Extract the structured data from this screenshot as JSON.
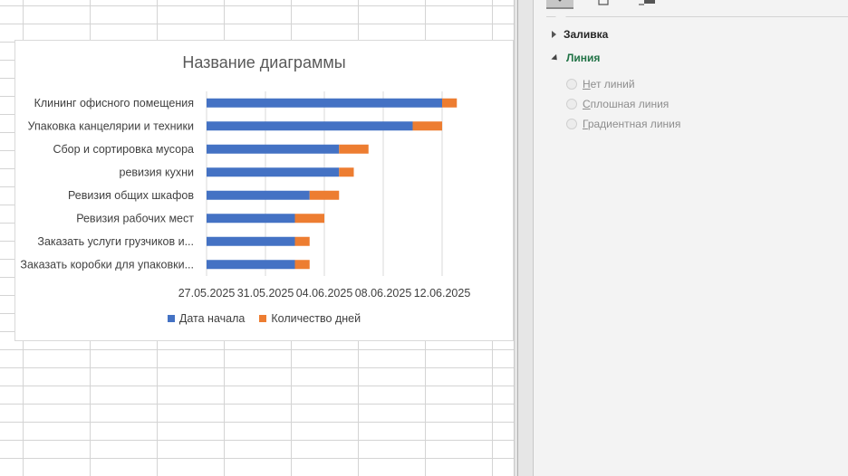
{
  "pane": {
    "sections": [
      {
        "label": "Заливка",
        "expanded": false
      },
      {
        "label": "Линия",
        "expanded": true
      }
    ],
    "line_options": [
      "Нет линий",
      "Сплошная линия",
      "Градиентная линия"
    ]
  },
  "chart_data": {
    "type": "bar",
    "orientation": "horizontal",
    "stacked": true,
    "title": "Название диаграммы",
    "categories": [
      "Заказать коробки для упаковки...",
      "Заказать услуги грузчиков и...",
      "Ревизия рабочих мест",
      "Ревизия общих шкафов",
      "ревизия кухни",
      "Сбор и сортировка мусора",
      "Упаковка канцелярии и техники",
      "Клининг офисного помещения"
    ],
    "series": [
      {
        "name": "Дата начала",
        "color": "#4472C4",
        "values": [
          "2025-06-02",
          "2025-06-02",
          "2025-06-02",
          "2025-06-03",
          "2025-06-05",
          "2025-06-05",
          "2025-06-10",
          "2025-06-12"
        ]
      },
      {
        "name": "Количество дней",
        "color": "#ED7D31",
        "values": [
          1,
          1,
          2,
          2,
          1,
          2,
          2,
          1
        ]
      }
    ],
    "x_axis": {
      "type": "date",
      "ticks": [
        "27.05.2025",
        "31.05.2025",
        "04.06.2025",
        "08.06.2025",
        "12.06.2025"
      ],
      "range": [
        "2025-05-27",
        "2025-06-12"
      ],
      "reversed_categories": true
    },
    "gridlines": true,
    "legend_position": "bottom"
  }
}
